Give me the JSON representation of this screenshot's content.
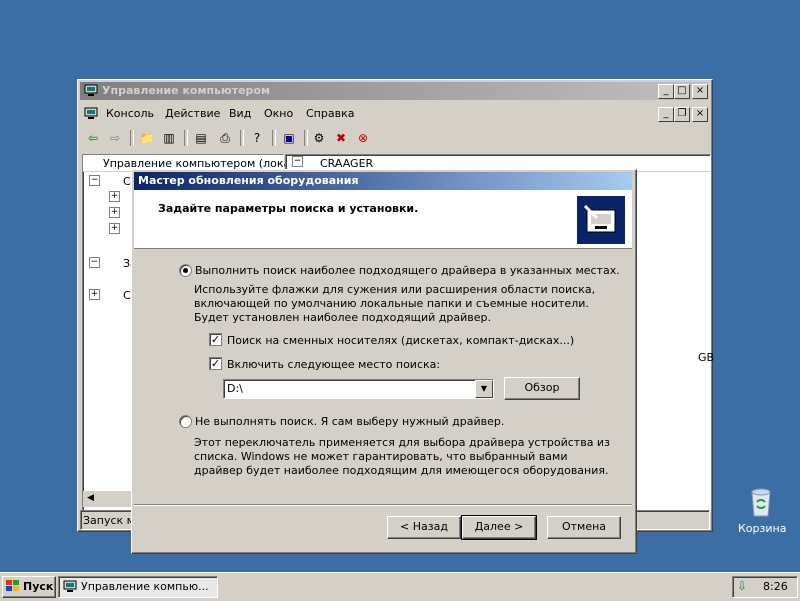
{
  "main_window": {
    "title": "Управление компьютером",
    "menu": [
      "Консоль",
      "Действие",
      "Вид",
      "Окно",
      "Справка"
    ],
    "tree_header": "Управление компьютером (локаль",
    "tree_items": [
      "Сл",
      "За",
      "Сл"
    ],
    "right_header": "CRAAGER",
    "right_fragment": "GB",
    "status": "Запуск ма"
  },
  "wizard": {
    "title": "Мастер обновления оборудования",
    "header": "Задайте параметры поиска и установки.",
    "option1": "Выполнить поиск наиболее подходящего драйвера в указанных местах.",
    "option1_desc": "Используйте флажки для сужения или расширения области поиска, включающей по умолчанию локальные папки и съемные носители. Будет установлен наиболее подходящий драйвер.",
    "check1": "Поиск на сменных носителях (дискетах, компакт-дисках...)",
    "check2": "Включить следующее место поиска:",
    "path": "D:\\",
    "browse": "Обзор",
    "option2": "Не выполнять поиск. Я сам выберу нужный драйвер.",
    "option2_desc": "Этот переключатель применяется для выбора драйвера устройства из списка. Windows не может гарантировать, что выбранный вами драйвер будет наиболее подходящим для имеющегося оборудования.",
    "back": "< Назад",
    "next": "Далее >",
    "cancel": "Отмена"
  },
  "taskbar": {
    "start": "Пуск",
    "task": "Управление компью...",
    "clock": "8:26"
  },
  "desktop": {
    "recycle_bin": "Корзина"
  }
}
